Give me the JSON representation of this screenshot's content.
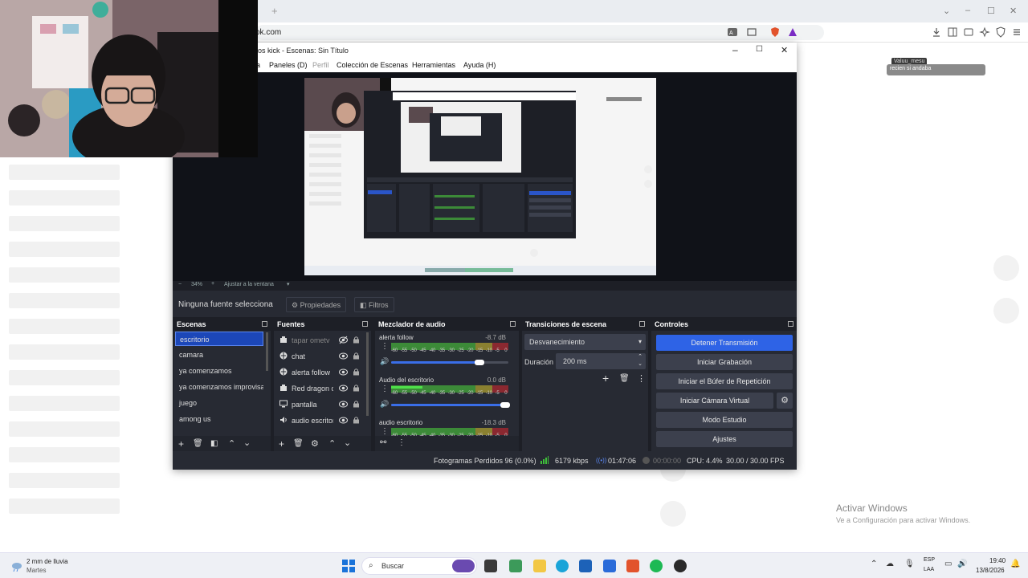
{
  "browser": {
    "address_partial": "ok.com",
    "tab_plus": "+",
    "window_controls": [
      "⌄",
      "–",
      "☐",
      "✕"
    ]
  },
  "chat_overlay": {
    "username": "Valuu_mesu",
    "message": "recien si andaba"
  },
  "obs": {
    "title": "os kick - Escenas: Sin Título",
    "menu": [
      "a",
      "Paneles (D)",
      "Perfil",
      "Colección de Escenas",
      "Herramientas",
      "Ayuda (H)"
    ],
    "zoom": {
      "minus": "−",
      "value": "34%",
      "plus": "+",
      "fit": "Ajustar a la ventana"
    },
    "toolbar": {
      "no_source": "Ninguna fuente seleccionad",
      "properties": "Propiedades",
      "filters": "Filtros"
    },
    "docks": {
      "scenes": {
        "title": "Escenas",
        "items": [
          "escritorio",
          "camara",
          "ya comenzamos",
          "ya comenzamos improvisa",
          "juego",
          "among us"
        ]
      },
      "sources": {
        "title": "Fuentes",
        "items": [
          {
            "name": "tapar ometv",
            "icon": "camera-icon",
            "hidden": true
          },
          {
            "name": "chat",
            "icon": "globe-icon",
            "hidden": false
          },
          {
            "name": "alerta follow",
            "icon": "globe-icon",
            "hidden": false
          },
          {
            "name": "Red dragon c",
            "icon": "camera-icon",
            "hidden": false
          },
          {
            "name": "pantalla",
            "icon": "monitor-icon",
            "hidden": false
          },
          {
            "name": "audio escritor",
            "icon": "speaker-icon",
            "hidden": false
          }
        ]
      },
      "mixer": {
        "title": "Mezclador de audio",
        "channels": [
          {
            "name": "alerta follow",
            "db": "-8.7 dB",
            "level": 0.0,
            "volume": 0.78
          },
          {
            "name": "Audio del escritorio",
            "db": "0.0 dB",
            "level": 0.27,
            "volume": 1.0
          },
          {
            "name": "audio escritorio",
            "db": "-18.3 dB",
            "level": 0.0,
            "volume": 0.7
          }
        ],
        "tick_labels": [
          "-60",
          "-55",
          "-50",
          "-45",
          "-40",
          "-35",
          "-30",
          "-25",
          "-20",
          "-15",
          "-10",
          "-5",
          "0"
        ]
      },
      "transitions": {
        "title": "Transiciones de escena",
        "selected": "Desvanecimiento",
        "duration_label": "Duración",
        "duration_value": "200 ms"
      },
      "controls": {
        "title": "Controles",
        "buttons": [
          "Detener Transmisión",
          "Iniciar Grabación",
          "Iniciar el Búfer de Repetición",
          "Iniciar Cámara Virtual",
          "Modo Estudio",
          "Ajustes"
        ]
      }
    },
    "status": {
      "dropped": "Fotogramas Perdidos 96 (0.0%)",
      "bitrate": "6179 kbps",
      "stream_time": "01:47:06",
      "rec_time": "00:00:00",
      "cpu": "CPU: 4.4%",
      "fps": "30.00 / 30.00 FPS"
    }
  },
  "desktop": {
    "activate_title": "Activar Windows",
    "activate_sub": "Ve a Configuración para activar Windows."
  },
  "taskbar": {
    "weather_line1": "2 mm de lluvia",
    "weather_line2": "Martes",
    "search": "Buscar",
    "lang1": "ESP",
    "lang2": "LAA",
    "time": "19:40",
    "date": "13/8/2026"
  },
  "colors": {
    "obs_bg": "#1d1f26",
    "obs_dock": "#272a33",
    "accent_blue": "#3a6ee8",
    "selected_scene": "#1c47b8"
  }
}
